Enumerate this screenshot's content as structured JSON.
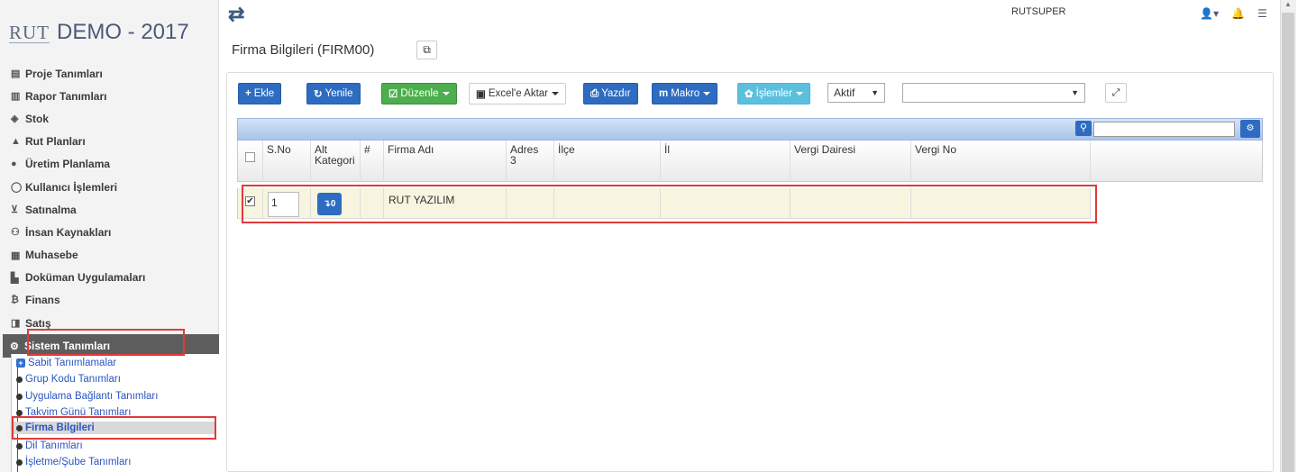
{
  "app": {
    "logo_text": "RUT",
    "title": "DEMO - 2017"
  },
  "topbar": {
    "user_name": "RUTSUPER"
  },
  "sidebar": {
    "items": [
      {
        "label": "Proje Tanımları",
        "icon": "book-icon"
      },
      {
        "label": "Rapor Tanımları",
        "icon": "bar-chart-icon"
      },
      {
        "label": "Stok",
        "icon": "cube-icon"
      },
      {
        "label": "Rut Planları",
        "icon": "road-icon"
      },
      {
        "label": "Üretim Planlama",
        "icon": "product-hunt-icon"
      },
      {
        "label": "Kullanıcı İşlemleri",
        "icon": "user-circle-icon"
      },
      {
        "label": "Satınalma",
        "icon": "cart-icon"
      },
      {
        "label": "İnsan Kaynakları",
        "icon": "users-icon"
      },
      {
        "label": "Muhasebe",
        "icon": "calculator-icon"
      },
      {
        "label": "Doküman Uygulamaları",
        "icon": "file-icon"
      },
      {
        "label": "Finans",
        "icon": "bitcoin-icon"
      },
      {
        "label": "Satış",
        "icon": "box-icon"
      },
      {
        "label": "Sistem Tanımları",
        "icon": "cogs-icon"
      }
    ],
    "submenu": {
      "group": "Sabit Tanımlamalar",
      "items": [
        "Grup Kodu Tanımları",
        "Uygulama Bağlantı Tanımları",
        "Takvim Günü Tanımları",
        "Firma Bilgileri",
        "Dil Tanımları",
        "İşletme/Şube Tanımları"
      ]
    }
  },
  "page": {
    "title": "Firma Bilgileri (FIRM00)"
  },
  "toolbar": {
    "add": "Ekle",
    "refresh": "Yenile",
    "edit": "Düzenle",
    "excel": "Excel'e Aktar",
    "print": "Yazdır",
    "macro": "Makro",
    "actions": "İşlemler",
    "status_select": "Aktif",
    "filter_select": ""
  },
  "grid": {
    "search_placeholder": "",
    "columns": [
      "S.No",
      "Alt Kategori",
      "#",
      "Firma Adı",
      "Adres 3",
      "İlçe",
      "İl",
      "Vergi Dairesi",
      "Vergi No"
    ],
    "column_lines": {
      "alt_kategori": [
        "Alt",
        "Kategori"
      ],
      "adres3": [
        "Adres",
        "3"
      ]
    },
    "rows": [
      {
        "checked": true,
        "sno": "1",
        "sub_count": "0",
        "hash": "",
        "firma_adi": "RUT YAZILIM",
        "adres3": "",
        "ilce": "",
        "il": "",
        "vergi_dairesi": "",
        "vergi_no": ""
      }
    ]
  },
  "colors": {
    "primary": "#2d6cc0",
    "success": "#4cae4c",
    "info": "#5bc0de",
    "highlight": "#e03a3a",
    "row_bg": "#f7f5e0"
  }
}
